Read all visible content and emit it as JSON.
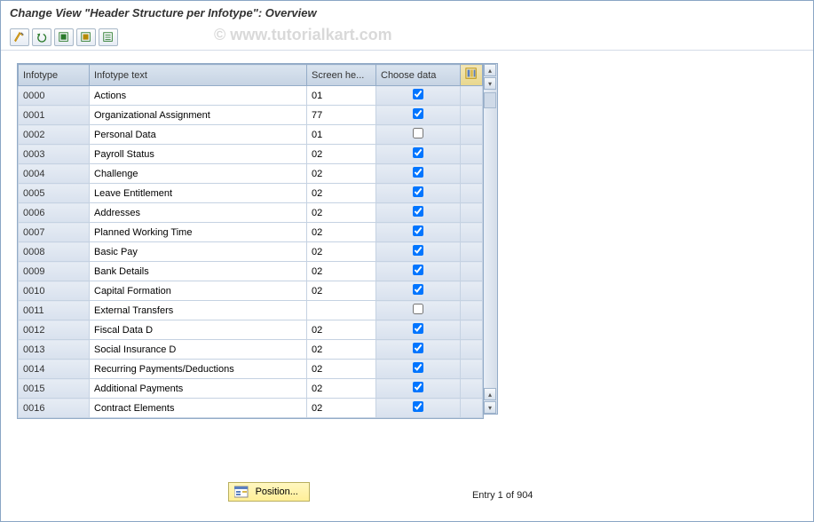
{
  "title": "Change View \"Header Structure per Infotype\": Overview",
  "watermark": "© www.tutorialkart.com",
  "columns": {
    "infotype": "Infotype",
    "infotype_text": "Infotype text",
    "screen_header": "Screen he...",
    "choose_data": "Choose data"
  },
  "rows": [
    {
      "id": "0000",
      "text": "Actions",
      "screen": "01",
      "checked": true
    },
    {
      "id": "0001",
      "text": "Organizational Assignment",
      "screen": "77",
      "checked": true
    },
    {
      "id": "0002",
      "text": "Personal Data",
      "screen": "01",
      "checked": false
    },
    {
      "id": "0003",
      "text": "Payroll Status",
      "screen": "02",
      "checked": true
    },
    {
      "id": "0004",
      "text": "Challenge",
      "screen": "02",
      "checked": true
    },
    {
      "id": "0005",
      "text": "Leave Entitlement",
      "screen": "02",
      "checked": true
    },
    {
      "id": "0006",
      "text": "Addresses",
      "screen": "02",
      "checked": true
    },
    {
      "id": "0007",
      "text": "Planned Working Time",
      "screen": "02",
      "checked": true
    },
    {
      "id": "0008",
      "text": "Basic Pay",
      "screen": "02",
      "checked": true
    },
    {
      "id": "0009",
      "text": "Bank Details",
      "screen": "02",
      "checked": true
    },
    {
      "id": "0010",
      "text": "Capital Formation",
      "screen": "02",
      "checked": true
    },
    {
      "id": "0011",
      "text": "External Transfers",
      "screen": "",
      "checked": false
    },
    {
      "id": "0012",
      "text": "Fiscal Data  D",
      "screen": "02",
      "checked": true
    },
    {
      "id": "0013",
      "text": "Social Insurance  D",
      "screen": "02",
      "checked": true
    },
    {
      "id": "0014",
      "text": "Recurring Payments/Deductions",
      "screen": "02",
      "checked": true
    },
    {
      "id": "0015",
      "text": "Additional Payments",
      "screen": "02",
      "checked": true
    },
    {
      "id": "0016",
      "text": "Contract Elements",
      "screen": "02",
      "checked": true
    }
  ],
  "position_button": "Position...",
  "entry_status": "Entry 1 of 904"
}
